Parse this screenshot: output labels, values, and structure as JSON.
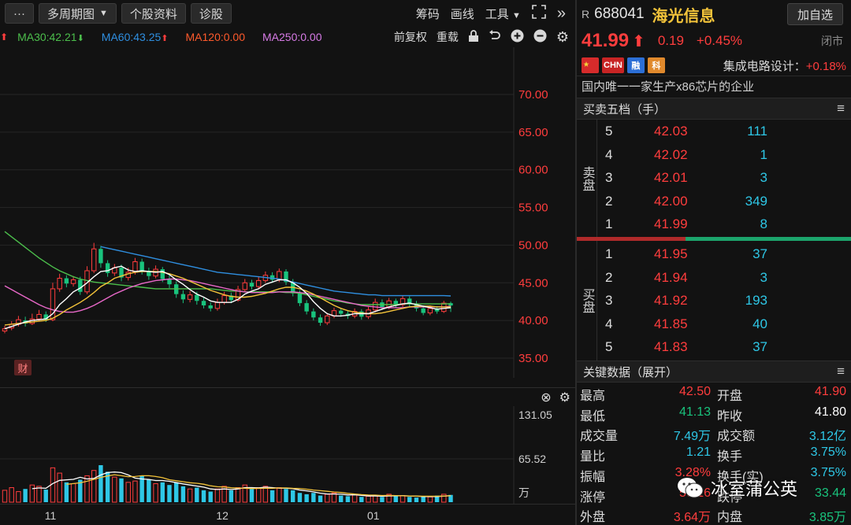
{
  "toolbar": {
    "more": "···",
    "period": "多周期图",
    "profile": "个股资料",
    "diagnose": "诊股",
    "chips": "筹码",
    "draw": "画线",
    "tools": "工具",
    "collapse": "»"
  },
  "ma_row": {
    "ma30": "MA30:42.21",
    "ma60": "MA60:43.25",
    "ma120": "MA120:0.00",
    "ma250": "MA250:0.00",
    "adjust": "前复权",
    "overlay": "重载"
  },
  "colors": {
    "up": "#ff3d3d",
    "down": "#19c37d",
    "ma5": "#ffffff",
    "ma10": "#f3c33a",
    "ma20": "#e868c8",
    "ma30": "#4cbf4c",
    "ma60": "#2f8fe0",
    "ma120": "#ff5a2c",
    "ma250": "#d77be6",
    "price_axis": "#ff3d3d"
  },
  "chart_data": [
    {
      "type": "candlestick",
      "title": "",
      "y_axis_labels": [
        "70.00",
        "65.00",
        "60.00",
        "55.00",
        "50.00",
        "45.00",
        "40.00",
        "35.00"
      ],
      "ylim": [
        35,
        72
      ],
      "x_labels": [
        "11",
        "12",
        "01"
      ],
      "badge": "财",
      "candles": [
        {
          "o": 38.6,
          "c": 38.9,
          "h": 39.3,
          "l": 38.3
        },
        {
          "o": 39.0,
          "c": 39.5,
          "h": 39.9,
          "l": 38.7
        },
        {
          "o": 39.5,
          "c": 40.1,
          "h": 40.6,
          "l": 39.2
        },
        {
          "o": 40.0,
          "c": 39.6,
          "h": 40.5,
          "l": 39.2
        },
        {
          "o": 39.6,
          "c": 40.2,
          "h": 40.9,
          "l": 39.4
        },
        {
          "o": 40.2,
          "c": 40.8,
          "h": 41.4,
          "l": 39.9
        },
        {
          "o": 40.8,
          "c": 40.1,
          "h": 41.2,
          "l": 39.8
        },
        {
          "o": 40.1,
          "c": 44.2,
          "h": 45.0,
          "l": 39.9
        },
        {
          "o": 44.2,
          "c": 45.6,
          "h": 46.2,
          "l": 43.8
        },
        {
          "o": 45.6,
          "c": 44.9,
          "h": 46.0,
          "l": 44.4
        },
        {
          "o": 44.9,
          "c": 45.4,
          "h": 45.9,
          "l": 44.5
        },
        {
          "o": 45.4,
          "c": 43.8,
          "h": 45.8,
          "l": 43.4
        },
        {
          "o": 43.8,
          "c": 46.6,
          "h": 47.2,
          "l": 43.5
        },
        {
          "o": 46.6,
          "c": 49.5,
          "h": 50.3,
          "l": 46.3
        },
        {
          "o": 49.5,
          "c": 47.6,
          "h": 49.9,
          "l": 47.0
        },
        {
          "o": 47.6,
          "c": 46.3,
          "h": 48.0,
          "l": 45.8
        },
        {
          "o": 46.3,
          "c": 47.0,
          "h": 47.5,
          "l": 45.9
        },
        {
          "o": 47.0,
          "c": 45.7,
          "h": 47.4,
          "l": 45.2
        },
        {
          "o": 45.7,
          "c": 46.4,
          "h": 47.0,
          "l": 45.3
        },
        {
          "o": 46.4,
          "c": 47.8,
          "h": 48.3,
          "l": 46.1
        },
        {
          "o": 47.8,
          "c": 46.6,
          "h": 48.2,
          "l": 46.1
        },
        {
          "o": 46.6,
          "c": 45.9,
          "h": 47.0,
          "l": 45.4
        },
        {
          "o": 45.9,
          "c": 46.8,
          "h": 47.3,
          "l": 45.6
        },
        {
          "o": 46.8,
          "c": 45.5,
          "h": 47.1,
          "l": 45.1
        },
        {
          "o": 45.5,
          "c": 44.8,
          "h": 46.0,
          "l": 44.3
        },
        {
          "o": 44.8,
          "c": 43.5,
          "h": 45.2,
          "l": 43.0
        },
        {
          "o": 43.5,
          "c": 42.8,
          "h": 44.0,
          "l": 42.3
        },
        {
          "o": 42.8,
          "c": 43.4,
          "h": 43.9,
          "l": 42.4
        },
        {
          "o": 43.4,
          "c": 42.6,
          "h": 43.8,
          "l": 42.1
        },
        {
          "o": 42.6,
          "c": 42.0,
          "h": 43.0,
          "l": 41.6
        },
        {
          "o": 42.0,
          "c": 41.6,
          "h": 42.4,
          "l": 41.2
        },
        {
          "o": 41.6,
          "c": 42.4,
          "h": 42.9,
          "l": 41.3
        },
        {
          "o": 42.4,
          "c": 43.3,
          "h": 43.8,
          "l": 42.1
        },
        {
          "o": 43.3,
          "c": 42.7,
          "h": 43.7,
          "l": 42.3
        },
        {
          "o": 42.7,
          "c": 44.1,
          "h": 44.6,
          "l": 42.5
        },
        {
          "o": 44.1,
          "c": 45.0,
          "h": 45.5,
          "l": 43.8
        },
        {
          "o": 45.0,
          "c": 44.5,
          "h": 45.4,
          "l": 44.1
        },
        {
          "o": 44.5,
          "c": 45.3,
          "h": 45.8,
          "l": 44.2
        },
        {
          "o": 45.3,
          "c": 46.0,
          "h": 46.5,
          "l": 45.0
        },
        {
          "o": 46.0,
          "c": 45.4,
          "h": 46.4,
          "l": 45.0
        },
        {
          "o": 45.4,
          "c": 46.5,
          "h": 46.9,
          "l": 45.1
        },
        {
          "o": 46.5,
          "c": 45.1,
          "h": 46.8,
          "l": 44.7
        },
        {
          "o": 45.1,
          "c": 43.6,
          "h": 45.5,
          "l": 43.2
        },
        {
          "o": 43.6,
          "c": 42.3,
          "h": 44.0,
          "l": 41.9
        },
        {
          "o": 42.3,
          "c": 41.2,
          "h": 42.7,
          "l": 40.8
        },
        {
          "o": 41.2,
          "c": 40.4,
          "h": 41.6,
          "l": 40.0
        },
        {
          "o": 40.4,
          "c": 39.7,
          "h": 40.8,
          "l": 39.3
        },
        {
          "o": 39.7,
          "c": 40.6,
          "h": 41.0,
          "l": 39.4
        },
        {
          "o": 40.6,
          "c": 41.3,
          "h": 41.7,
          "l": 40.3
        },
        {
          "o": 41.3,
          "c": 40.9,
          "h": 41.6,
          "l": 40.5
        },
        {
          "o": 40.9,
          "c": 40.6,
          "h": 41.3,
          "l": 40.2
        },
        {
          "o": 40.6,
          "c": 41.2,
          "h": 41.6,
          "l": 40.3
        },
        {
          "o": 41.2,
          "c": 40.5,
          "h": 41.5,
          "l": 40.1
        },
        {
          "o": 40.5,
          "c": 41.4,
          "h": 41.8,
          "l": 40.2
        },
        {
          "o": 41.4,
          "c": 42.4,
          "h": 42.9,
          "l": 41.1
        },
        {
          "o": 42.4,
          "c": 41.8,
          "h": 42.8,
          "l": 41.4
        },
        {
          "o": 41.8,
          "c": 42.6,
          "h": 43.0,
          "l": 41.5
        },
        {
          "o": 42.6,
          "c": 42.1,
          "h": 42.9,
          "l": 41.7
        },
        {
          "o": 42.1,
          "c": 42.9,
          "h": 43.3,
          "l": 41.8
        },
        {
          "o": 42.9,
          "c": 42.2,
          "h": 43.2,
          "l": 41.8
        },
        {
          "o": 42.2,
          "c": 41.6,
          "h": 42.6,
          "l": 41.2
        },
        {
          "o": 41.6,
          "c": 41.0,
          "h": 42.0,
          "l": 40.7
        },
        {
          "o": 41.0,
          "c": 41.6,
          "h": 42.0,
          "l": 40.7
        },
        {
          "o": 41.6,
          "c": 41.2,
          "h": 41.9,
          "l": 40.9
        },
        {
          "o": 41.2,
          "c": 42.3,
          "h": 42.6,
          "l": 41.0
        },
        {
          "o": 42.3,
          "c": 41.99,
          "h": 42.5,
          "l": 41.13
        }
      ],
      "ma5": [
        38.9,
        39.2,
        39.5,
        39.8,
        40.0,
        40.1,
        40.2,
        40.9,
        42.1,
        42.9,
        43.8,
        44.3,
        45.0,
        45.8,
        46.5,
        46.6,
        47.0,
        47.2,
        46.7,
        46.5,
        46.6,
        46.5,
        46.4,
        46.5,
        46.1,
        45.4,
        44.8,
        44.1,
        43.5,
        43.1,
        42.6,
        42.4,
        42.4,
        42.4,
        42.8,
        43.5,
        43.9,
        44.2,
        44.8,
        45.1,
        45.4,
        45.4,
        45.0,
        44.4,
        43.6,
        42.5,
        41.6,
        40.9,
        40.6,
        40.6,
        40.7,
        40.9,
        40.9,
        40.9,
        41.2,
        41.5,
        41.8,
        42.0,
        42.2,
        42.3,
        42.1,
        41.9,
        41.7,
        41.5,
        41.6,
        41.7
      ],
      "ma10": [
        39.4,
        39.5,
        39.6,
        39.7,
        39.8,
        39.9,
        40.0,
        40.3,
        40.8,
        41.4,
        41.9,
        42.4,
        43.0,
        43.7,
        44.5,
        45.0,
        45.6,
        45.9,
        46.2,
        46.4,
        46.5,
        46.5,
        46.5,
        46.4,
        46.2,
        45.9,
        45.6,
        45.2,
        44.8,
        44.4,
        44.0,
        43.7,
        43.4,
        43.2,
        43.1,
        43.1,
        43.2,
        43.4,
        43.6,
        43.9,
        44.2,
        44.4,
        44.4,
        44.2,
        43.9,
        43.5,
        43.0,
        42.5,
        42.0,
        41.6,
        41.3,
        41.1,
        41.0,
        40.9,
        40.9,
        41.0,
        41.2,
        41.4,
        41.6,
        41.8,
        41.9,
        41.9,
        41.9,
        41.8,
        41.8,
        41.8
      ],
      "ma20": [
        44.6,
        44.1,
        43.6,
        43.1,
        42.6,
        42.1,
        41.7,
        41.4,
        41.2,
        41.1,
        41.1,
        41.3,
        41.6,
        42.0,
        42.5,
        43.0,
        43.5,
        43.9,
        44.3,
        44.6,
        44.9,
        45.1,
        45.3,
        45.4,
        45.5,
        45.5,
        45.4,
        45.3,
        45.1,
        44.9,
        44.7,
        44.5,
        44.3,
        44.1,
        43.9,
        43.8,
        43.7,
        43.7,
        43.7,
        43.7,
        43.8,
        43.8,
        43.8,
        43.7,
        43.6,
        43.4,
        43.2,
        43.0,
        42.8,
        42.6,
        42.4,
        42.2,
        42.0,
        41.9,
        41.8,
        41.7,
        41.7,
        41.7,
        41.7,
        41.8,
        41.8,
        41.8,
        41.8,
        41.8,
        41.8,
        41.9
      ],
      "ma30": [
        51.8,
        51.1,
        50.4,
        49.7,
        49.0,
        48.3,
        47.7,
        47.1,
        46.6,
        46.2,
        45.8,
        45.5,
        45.3,
        45.1,
        45.0,
        44.9,
        44.8,
        44.7,
        44.6,
        44.5,
        44.4,
        44.3,
        44.2,
        44.2,
        44.2,
        44.2,
        44.2,
        44.2,
        44.2,
        44.2,
        44.2,
        44.1,
        44.0,
        43.9,
        43.9,
        43.8,
        43.8,
        43.8,
        43.8,
        43.8,
        43.8,
        43.7,
        43.7,
        43.6,
        43.4,
        43.2,
        43.0,
        42.8,
        42.6,
        42.5,
        42.3,
        42.2,
        42.1,
        42.1,
        42.1,
        42.1,
        42.1,
        42.1,
        42.2,
        42.2,
        42.2,
        42.2,
        42.2,
        42.2,
        42.2,
        42.21
      ],
      "ma60": [
        null,
        null,
        null,
        null,
        null,
        null,
        null,
        null,
        null,
        null,
        null,
        null,
        null,
        null,
        49.8,
        49.6,
        49.4,
        49.2,
        49.0,
        48.8,
        48.6,
        48.4,
        48.2,
        48.0,
        47.8,
        47.6,
        47.4,
        47.2,
        47.0,
        46.8,
        46.6,
        46.4,
        46.3,
        46.2,
        46.1,
        46.0,
        45.9,
        45.8,
        45.7,
        45.6,
        45.5,
        45.3,
        45.1,
        44.9,
        44.7,
        44.5,
        44.3,
        44.1,
        43.9,
        43.8,
        43.7,
        43.6,
        43.5,
        43.4,
        43.4,
        43.3,
        43.3,
        43.3,
        43.3,
        43.3,
        43.3,
        43.3,
        43.3,
        43.3,
        43.3,
        43.25
      ]
    },
    {
      "type": "bar",
      "title": "",
      "y_axis_labels": [
        "131.05",
        "65.52",
        "万"
      ],
      "ylim": [
        0,
        131.05
      ],
      "values": [
        18,
        22,
        16,
        20,
        26,
        24,
        19,
        52,
        44,
        30,
        28,
        34,
        40,
        48,
        56,
        46,
        38,
        36,
        30,
        32,
        40,
        34,
        28,
        30,
        26,
        30,
        24,
        20,
        22,
        18,
        16,
        20,
        24,
        18,
        22,
        26,
        20,
        22,
        24,
        18,
        22,
        20,
        18,
        14,
        12,
        14,
        10,
        12,
        14,
        10,
        9,
        11,
        8,
        9,
        10,
        8,
        12,
        9,
        10,
        8,
        7,
        9,
        8,
        10,
        12,
        11
      ]
    }
  ],
  "vol_tools": {
    "close": "⊗",
    "settings": "⚙"
  },
  "stock": {
    "r": "R",
    "code": "688041",
    "name": "海光信息",
    "add_watch": "加自选",
    "price": "41.99",
    "arrow": "⬆",
    "change": "0.19",
    "change_pct": "+0.45%",
    "status": "闭市",
    "tag_chn": "CHN",
    "tag_rong": "融",
    "tag_ke": "科",
    "sector": "集成电路设计：",
    "sector_pct": "+0.18%",
    "description": "国内唯一一家生产x86芯片的企业"
  },
  "orderbook": {
    "title": "买卖五档（手）",
    "sell_label": "卖盘",
    "buy_label": "买盘",
    "asks": [
      {
        "level": "5",
        "price": "42.03",
        "volume": "111"
      },
      {
        "level": "4",
        "price": "42.02",
        "volume": "1"
      },
      {
        "level": "3",
        "price": "42.01",
        "volume": "3"
      },
      {
        "level": "2",
        "price": "42.00",
        "volume": "349"
      },
      {
        "level": "1",
        "price": "41.99",
        "volume": "8"
      }
    ],
    "bids": [
      {
        "level": "1",
        "price": "41.95",
        "volume": "37"
      },
      {
        "level": "2",
        "price": "41.94",
        "volume": "3"
      },
      {
        "level": "3",
        "price": "41.92",
        "volume": "193"
      },
      {
        "level": "4",
        "price": "41.85",
        "volume": "40"
      },
      {
        "level": "5",
        "price": "41.83",
        "volume": "37"
      }
    ]
  },
  "keydata": {
    "title": "关键数据（展开）",
    "rows": [
      {
        "l1": "最高",
        "v1": "42.50",
        "l2": "开盘",
        "v2": "41.90"
      },
      {
        "l1": "最低",
        "v1": "41.13",
        "l2": "昨收",
        "v2": "41.80"
      },
      {
        "l1": "成交量",
        "v1": "7.49万",
        "l2": "成交额",
        "v2": "3.12亿"
      },
      {
        "l1": "量比",
        "v1": "1.21",
        "l2": "换手",
        "v2": "3.75%"
      },
      {
        "l1": "振幅",
        "v1": "3.28%",
        "l2": "换手(实)",
        "v2": "3.75%"
      },
      {
        "l1": "涨停",
        "v1": "50.16",
        "l2": "跌停",
        "v2": "33.44"
      },
      {
        "l1": "外盘",
        "v1": "3.64万",
        "l2": "内盘",
        "v2": "3.85万"
      }
    ]
  },
  "watermark": {
    "text": "冰室蒲公英"
  }
}
